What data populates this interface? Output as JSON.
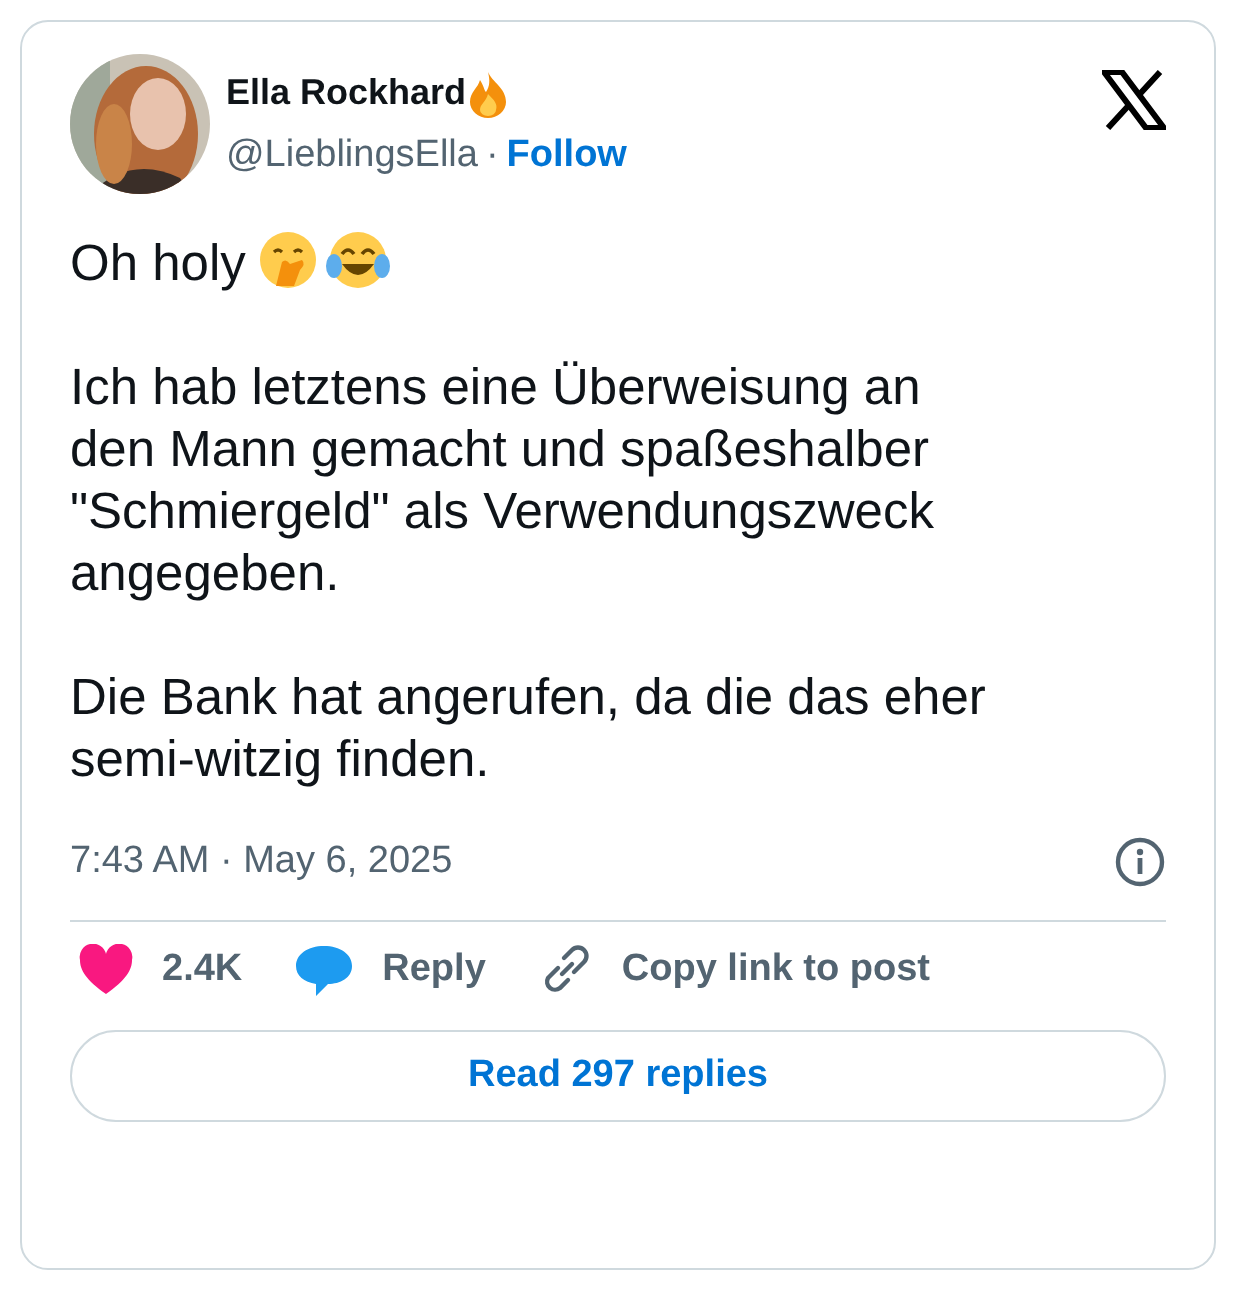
{
  "author": {
    "name": "Ella Rockhard",
    "handle": "@LieblingsElla",
    "separator": "·",
    "follow": "Follow"
  },
  "paragraphs": [
    {
      "text": "Oh holy",
      "emojis": [
        {
          "kind": "hand"
        },
        {
          "kind": "joy"
        }
      ]
    },
    {
      "text": "Ich hab letztens eine Überweisung an den Mann gemacht und spaßeshalber \"Schmiergeld\" als Verwendungszweck angegeben."
    },
    {
      "text": "Die Bank hat angerufen, da die das eher semi-witzig finden."
    }
  ],
  "timestamp": "7:43 AM · May 6, 2025",
  "actions": [
    {
      "kind": "like",
      "label": "2.4K"
    },
    {
      "kind": "reply",
      "label": "Reply"
    },
    {
      "kind": "copy",
      "label": "Copy link to post"
    }
  ],
  "read_replies": "Read 297 replies"
}
